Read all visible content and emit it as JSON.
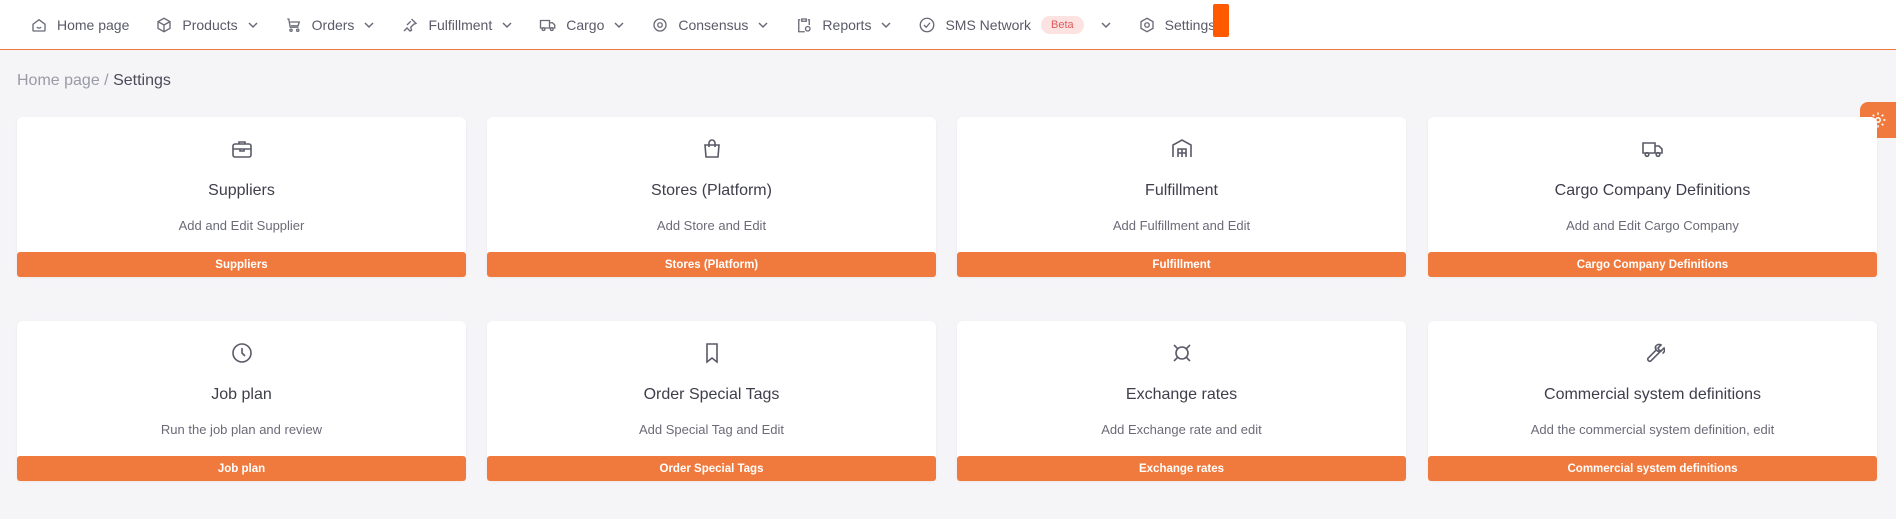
{
  "nav": {
    "items": [
      {
        "label": "Home page",
        "icon": "home-icon",
        "dropdown": false
      },
      {
        "label": "Products",
        "icon": "box-icon",
        "dropdown": true
      },
      {
        "label": "Orders",
        "icon": "cart-icon",
        "dropdown": true
      },
      {
        "label": "Fulfillment",
        "icon": "pin-icon",
        "dropdown": true
      },
      {
        "label": "Cargo",
        "icon": "truck-icon",
        "dropdown": true
      },
      {
        "label": "Consensus",
        "icon": "sync-icon",
        "dropdown": true
      },
      {
        "label": "Reports",
        "icon": "clipboard-icon",
        "dropdown": true
      },
      {
        "label": "SMS Network",
        "icon": "check-circle-icon",
        "dropdown": true,
        "badge": "Beta"
      },
      {
        "label": "Settings",
        "icon": "hex-gear-icon",
        "dropdown": false
      }
    ]
  },
  "breadcrumb": {
    "parent": "Home page",
    "separator": " / ",
    "current": "Settings"
  },
  "cards": [
    {
      "title": "Suppliers",
      "description": "Add and Edit Supplier",
      "button": "Suppliers",
      "icon": "briefcase-icon"
    },
    {
      "title": "Stores (Platform)",
      "description": "Add Store and Edit",
      "button": "Stores (Platform)",
      "icon": "shopping-bag-icon"
    },
    {
      "title": "Fulfillment",
      "description": "Add Fulfillment and Edit",
      "button": "Fulfillment",
      "icon": "warehouse-icon"
    },
    {
      "title": "Cargo Company Definitions",
      "description": "Add and Edit Cargo Company",
      "button": "Cargo Company Definitions",
      "icon": "truck-icon"
    },
    {
      "title": "Job plan",
      "description": "Run the job plan and review",
      "button": "Job plan",
      "icon": "clock-icon"
    },
    {
      "title": "Order Special Tags",
      "description": "Add Special Tag and Edit",
      "button": "Order Special Tags",
      "icon": "bookmark-icon"
    },
    {
      "title": "Exchange rates",
      "description": "Add Exchange rate and edit",
      "button": "Exchange rates",
      "icon": "currency-icon"
    },
    {
      "title": "Commercial system definitions",
      "description": "Add the commercial system definition, edit",
      "button": "Commercial system definitions",
      "icon": "wrench-icon"
    }
  ],
  "colors": {
    "accent": "#f07a3e",
    "marker": "#ff5a00",
    "beta_bg": "#fde2e2",
    "beta_text": "#e05b5b"
  }
}
